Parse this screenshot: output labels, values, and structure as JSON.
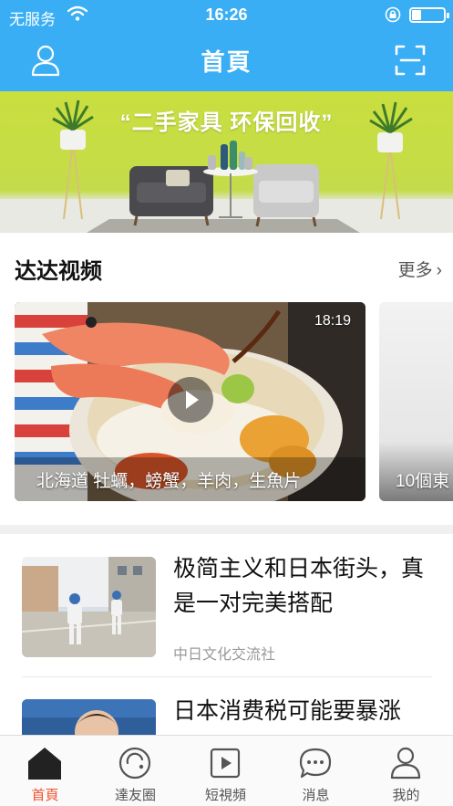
{
  "status_bar": {
    "carrier": "无服务",
    "time": "16:26",
    "battery_level": 0.3
  },
  "header": {
    "title": "首頁",
    "left_icon": "user-icon",
    "right_icon": "scan-icon"
  },
  "banner": {
    "title": "“二手家具  环保回收”"
  },
  "videos_section": {
    "title": "达达视频",
    "more_label": "更多",
    "videos": [
      {
        "duration": "18:19",
        "caption": "北海道 牡蠣，螃蟹，羊肉，生魚片"
      },
      {
        "duration": "",
        "caption": "10個東"
      }
    ]
  },
  "articles": [
    {
      "title": "极简主义和日本街头，真是一对完美搭配",
      "source": "中日文化交流社"
    },
    {
      "title": "日本消费税可能要暴涨",
      "source": ""
    }
  ],
  "tab_bar": {
    "active": 0,
    "tabs": [
      {
        "label": "首頁",
        "icon": "home-icon"
      },
      {
        "label": "達友圈",
        "icon": "circle-icon"
      },
      {
        "label": "短視頻",
        "icon": "video-icon"
      },
      {
        "label": "消息",
        "icon": "message-icon"
      },
      {
        "label": "我的",
        "icon": "profile-icon"
      }
    ]
  },
  "colors": {
    "header_blue": "#3aaef4",
    "active_tab": "#f0522d",
    "banner_green": "#c9df3e"
  }
}
